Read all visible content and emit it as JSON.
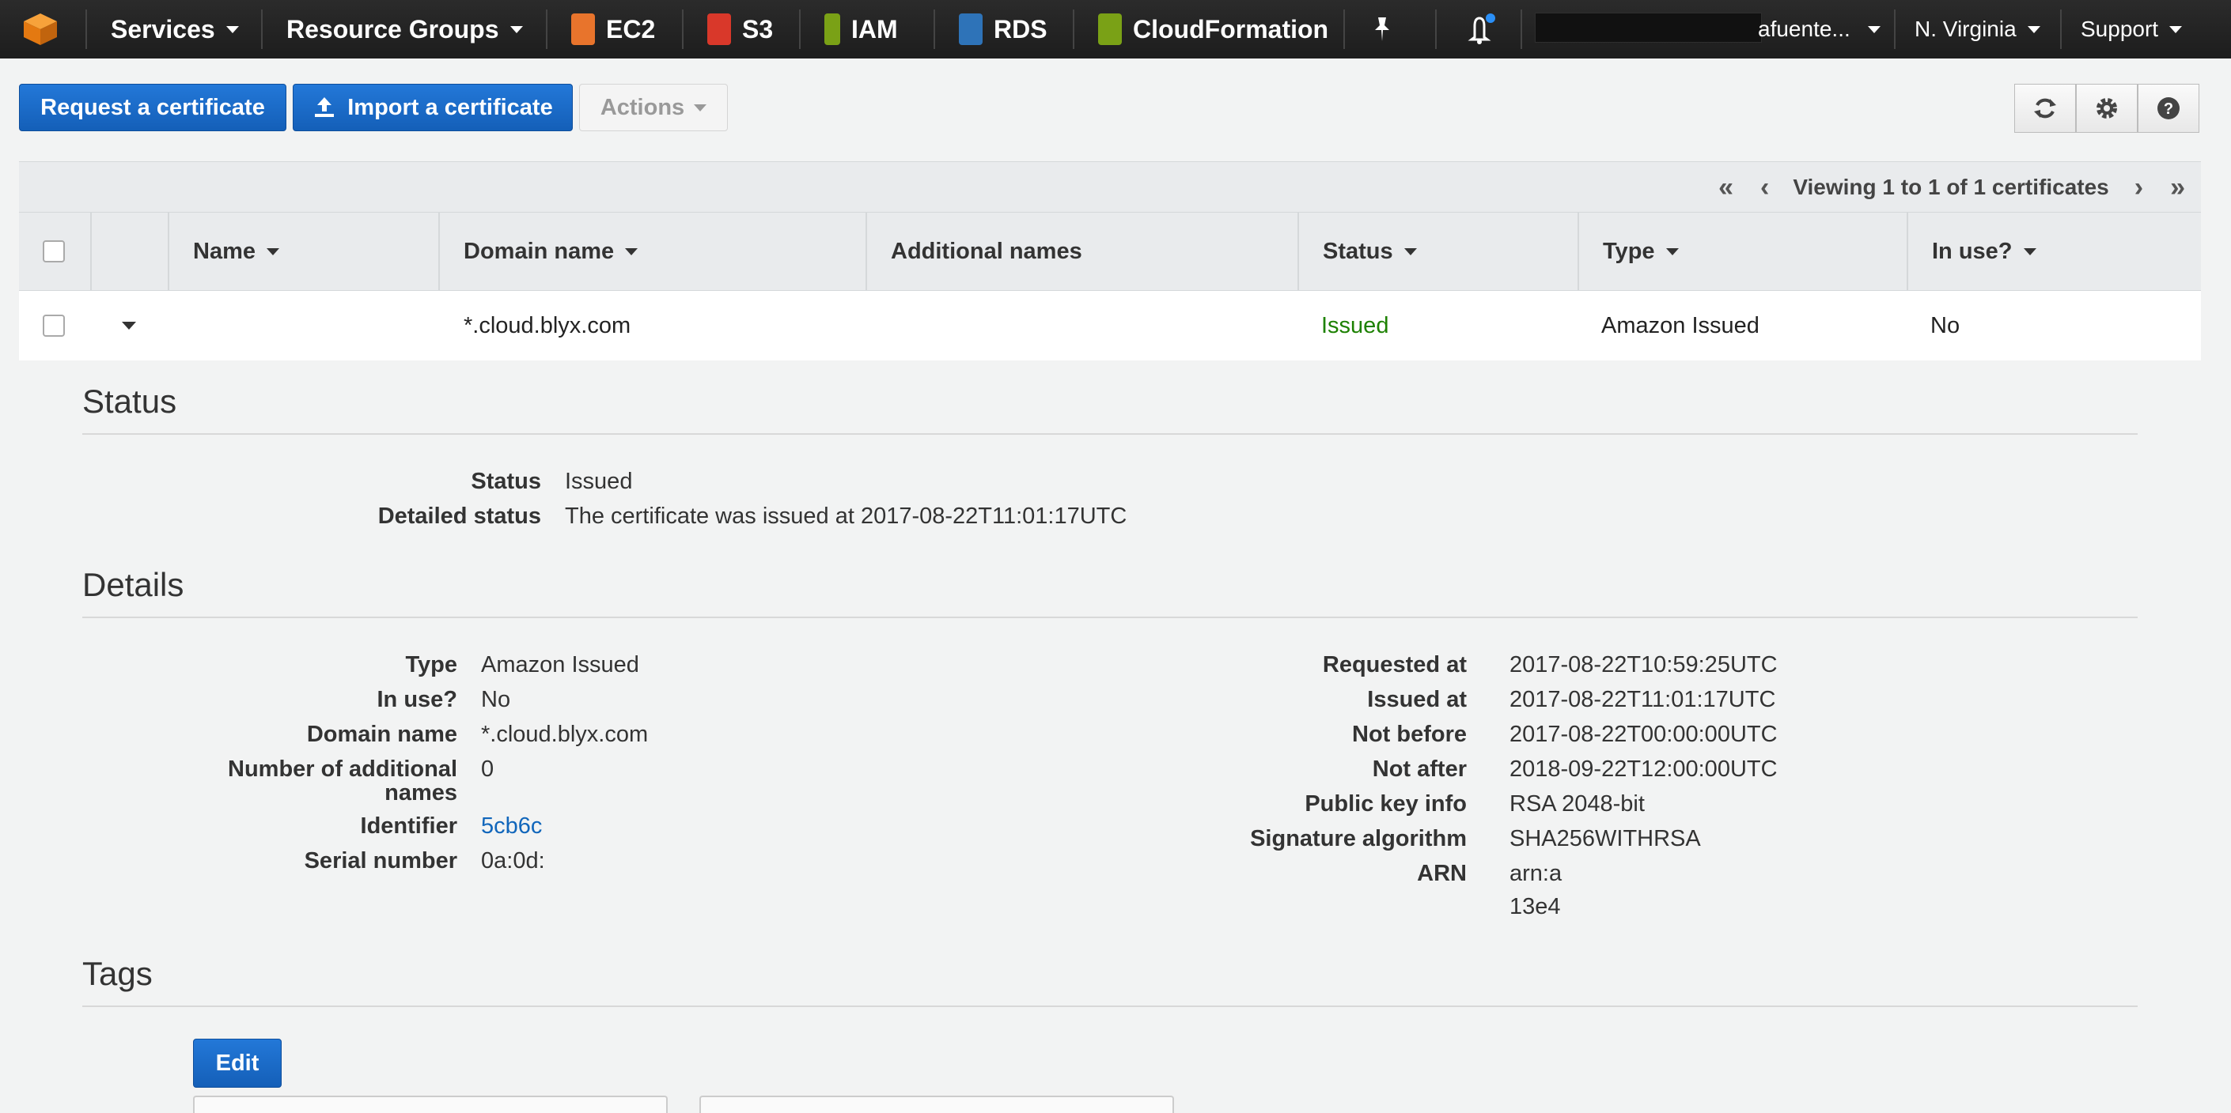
{
  "nav": {
    "services": "Services",
    "resource_groups": "Resource Groups",
    "shortcuts": [
      {
        "label": "EC2",
        "color": "#e8742c"
      },
      {
        "label": "S3",
        "color": "#d9382a"
      },
      {
        "label": "IAM",
        "color": "#7aa116"
      },
      {
        "label": "RDS",
        "color": "#2e73b8"
      },
      {
        "label": "CloudFormation",
        "color": "#7aa116"
      }
    ],
    "user": "afuente...",
    "region": "N. Virginia",
    "support": "Support"
  },
  "toolbar": {
    "request_label": "Request a certificate",
    "import_label": "Import a certificate",
    "actions_label": "Actions"
  },
  "pager": {
    "text": "Viewing 1 to 1 of 1 certificates"
  },
  "table": {
    "columns": [
      "Name",
      "Domain name",
      "Additional names",
      "Status",
      "Type",
      "In use?"
    ],
    "rows": [
      {
        "name": "",
        "domain": "*.cloud.blyx.com",
        "additional": "",
        "status": "Issued",
        "type": "Amazon Issued",
        "in_use": "No"
      }
    ]
  },
  "status_section": {
    "title": "Status",
    "status_label": "Status",
    "status_value": "Issued",
    "detailed_label": "Detailed status",
    "detailed_value": "The certificate was issued at 2017-08-22T11:01:17UTC"
  },
  "details_section": {
    "title": "Details",
    "left": [
      {
        "label": "Type",
        "value": "Amazon Issued"
      },
      {
        "label": "In use?",
        "value": "No"
      },
      {
        "label": "Domain name",
        "value": "*.cloud.blyx.com"
      },
      {
        "label": "Number of additional names",
        "value": "0"
      },
      {
        "label": "Identifier",
        "value": "5cb6c"
      },
      {
        "label": "Serial number",
        "value": "0a:0d:"
      }
    ],
    "right": [
      {
        "label": "Requested at",
        "value": "2017-08-22T10:59:25UTC"
      },
      {
        "label": "Issued at",
        "value": "2017-08-22T11:01:17UTC"
      },
      {
        "label": "Not before",
        "value": "2017-08-22T00:00:00UTC"
      },
      {
        "label": "Not after",
        "value": "2018-09-22T12:00:00UTC"
      },
      {
        "label": "Public key info",
        "value": "RSA 2048-bit"
      },
      {
        "label": "Signature algorithm",
        "value": "SHA256WITHRSA"
      },
      {
        "label": "ARN",
        "value": "arn:a",
        "value2": "13e4"
      }
    ]
  },
  "tags_section": {
    "title": "Tags",
    "edit_label": "Edit"
  },
  "colors": {
    "primary": "#1666c5",
    "issued_green": "#1d8102",
    "link": "#1166bb",
    "nav_bg": "#232323"
  }
}
